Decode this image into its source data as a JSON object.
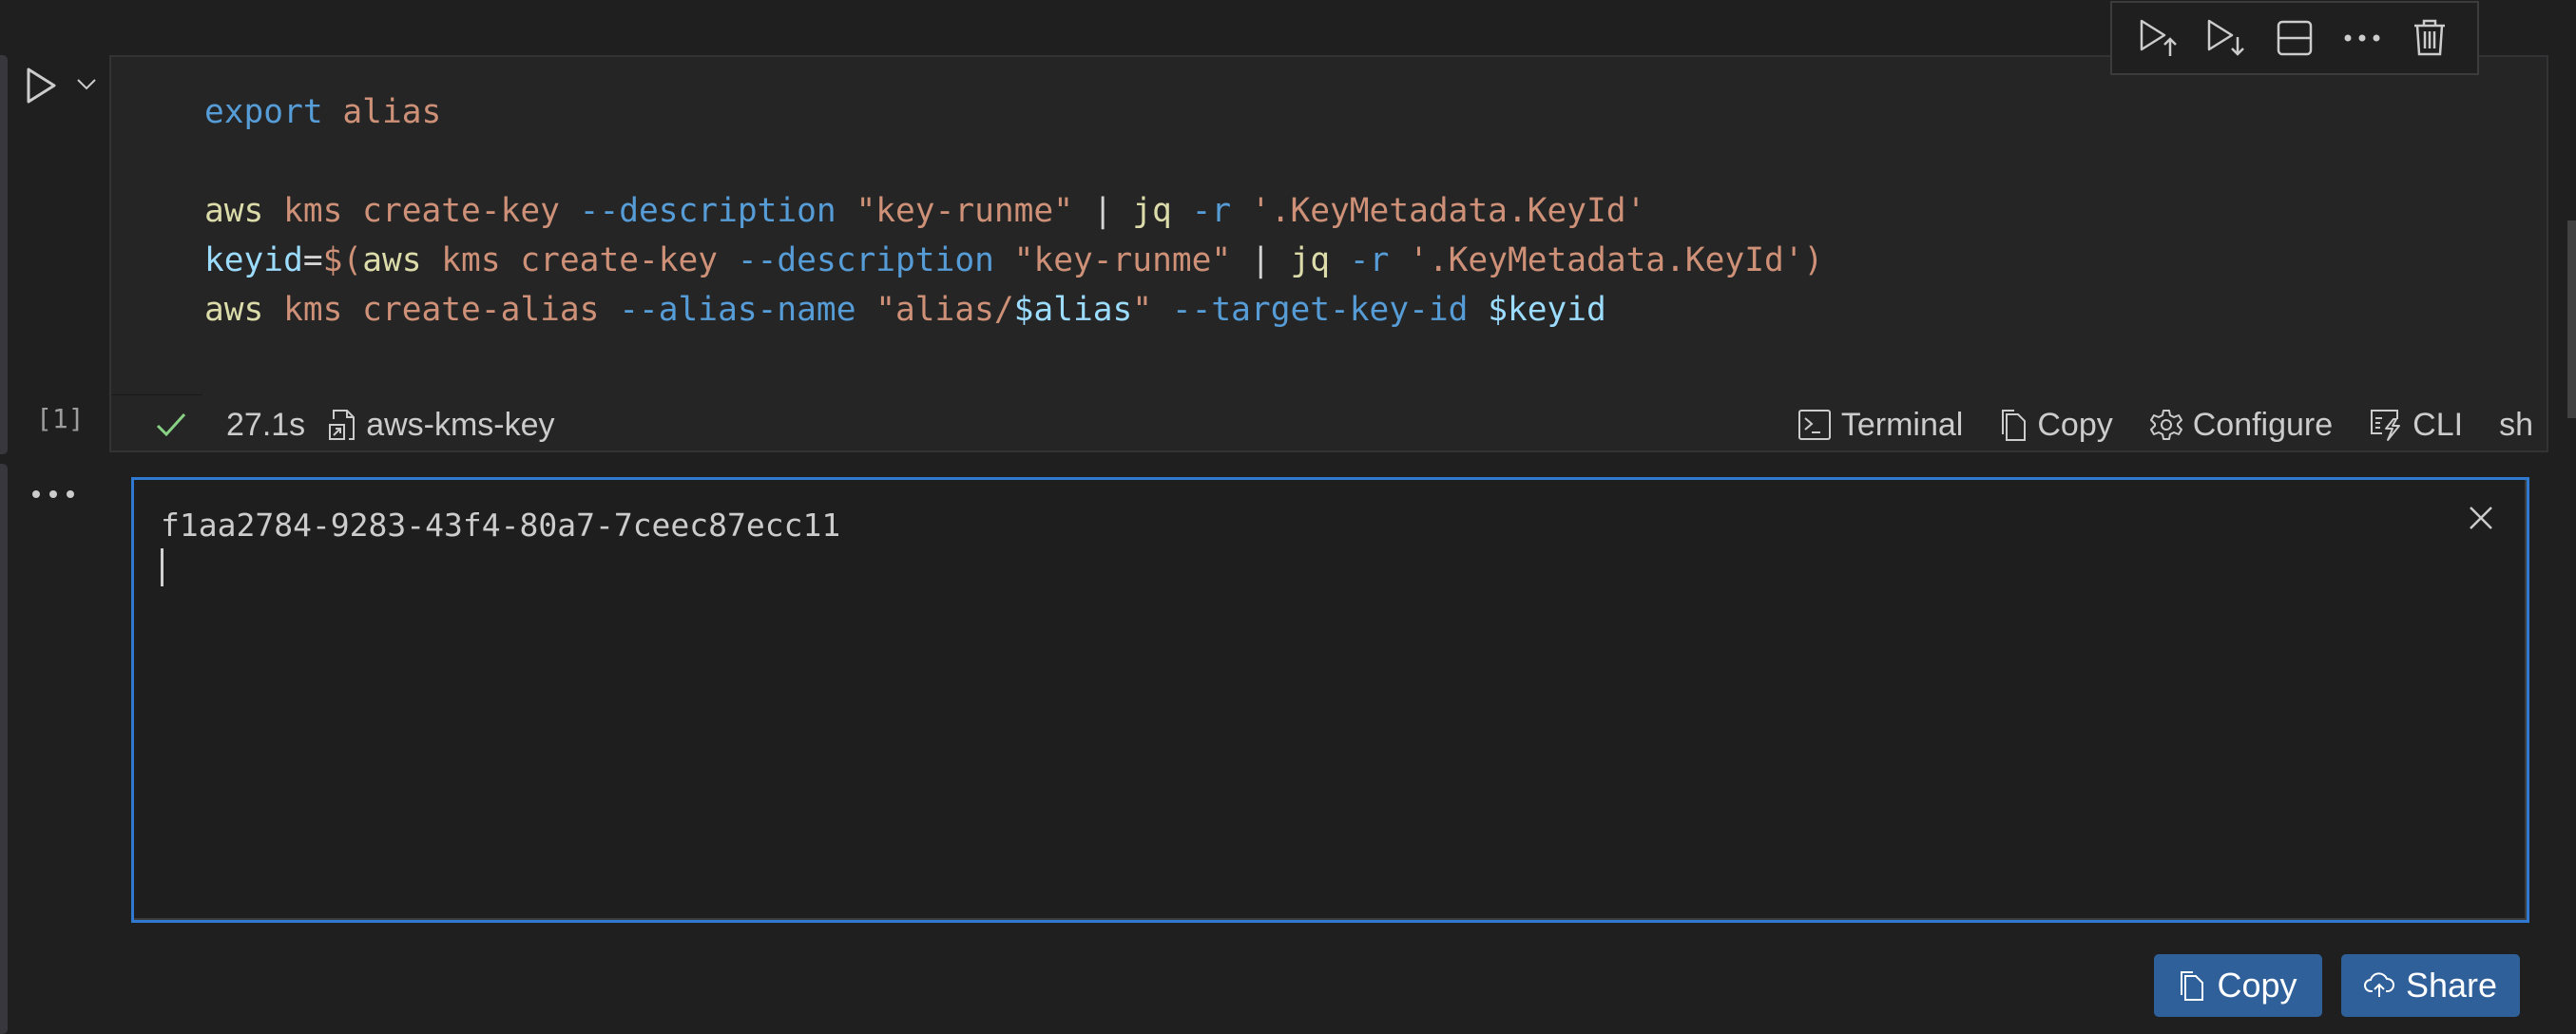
{
  "cell": {
    "execution_count": "[1]",
    "code_lines": [
      [
        {
          "t": "export",
          "c": "kw"
        },
        {
          "t": " ",
          "c": "op"
        },
        {
          "t": "alias",
          "c": "str"
        }
      ],
      [],
      [
        {
          "t": "aws",
          "c": "fn"
        },
        {
          "t": " ",
          "c": "op"
        },
        {
          "t": "kms create-key",
          "c": "str"
        },
        {
          "t": " ",
          "c": "op"
        },
        {
          "t": "--description",
          "c": "flag"
        },
        {
          "t": " ",
          "c": "op"
        },
        {
          "t": "\"key-runme\"",
          "c": "str"
        },
        {
          "t": " | ",
          "c": "op"
        },
        {
          "t": "jq",
          "c": "fn"
        },
        {
          "t": " ",
          "c": "op"
        },
        {
          "t": "-r",
          "c": "flag"
        },
        {
          "t": " ",
          "c": "op"
        },
        {
          "t": "'.KeyMetadata.KeyId'",
          "c": "str"
        }
      ],
      [
        {
          "t": "keyid",
          "c": "var"
        },
        {
          "t": "=",
          "c": "op"
        },
        {
          "t": "$(",
          "c": "str"
        },
        {
          "t": "aws",
          "c": "fn"
        },
        {
          "t": " ",
          "c": "op"
        },
        {
          "t": "kms create-key",
          "c": "str"
        },
        {
          "t": " ",
          "c": "op"
        },
        {
          "t": "--description",
          "c": "flag"
        },
        {
          "t": " ",
          "c": "op"
        },
        {
          "t": "\"key-runme\"",
          "c": "str"
        },
        {
          "t": " | ",
          "c": "op"
        },
        {
          "t": "jq",
          "c": "fn"
        },
        {
          "t": " ",
          "c": "op"
        },
        {
          "t": "-r",
          "c": "flag"
        },
        {
          "t": " ",
          "c": "op"
        },
        {
          "t": "'.KeyMetadata.KeyId')",
          "c": "str"
        }
      ],
      [
        {
          "t": "aws",
          "c": "fn"
        },
        {
          "t": " ",
          "c": "op"
        },
        {
          "t": "kms create-alias",
          "c": "str"
        },
        {
          "t": " ",
          "c": "op"
        },
        {
          "t": "--alias-name",
          "c": "flag"
        },
        {
          "t": " ",
          "c": "op"
        },
        {
          "t": "\"alias/",
          "c": "str"
        },
        {
          "t": "$alias",
          "c": "var"
        },
        {
          "t": "\"",
          "c": "str"
        },
        {
          "t": " ",
          "c": "op"
        },
        {
          "t": "--target-key-id",
          "c": "flag"
        },
        {
          "t": " ",
          "c": "op"
        },
        {
          "t": "$keyid",
          "c": "var"
        }
      ]
    ],
    "status": {
      "duration": "27.1s",
      "cell_name": "aws-kms-key",
      "actions": {
        "terminal": "Terminal",
        "copy": "Copy",
        "configure": "Configure",
        "cli": "CLI",
        "language": "sh"
      }
    }
  },
  "output": {
    "text": "f1aa2784-9283-43f4-80a7-7ceec87ecc11",
    "buttons": {
      "copy": "Copy",
      "share": "Share"
    }
  },
  "toolbar": {
    "items": [
      "execute-above-icon",
      "execute-below-icon",
      "split-cell-icon",
      "more-icon",
      "delete-icon"
    ]
  },
  "colors": {
    "accent": "#3079d0",
    "button": "#2f6099",
    "success": "#89d185"
  }
}
